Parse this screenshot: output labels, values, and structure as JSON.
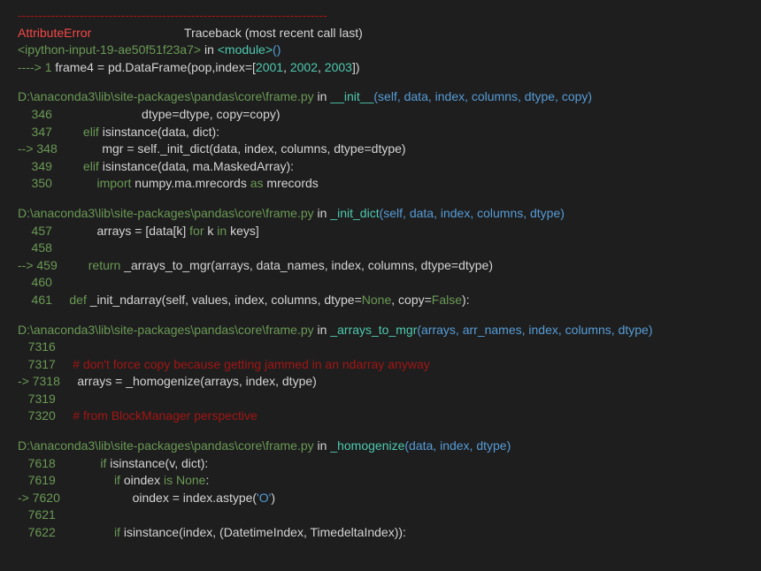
{
  "header": {
    "separator": "---------------------------------------------------------------------------",
    "error_name": "AttributeError",
    "traceback_label": "Traceback (most recent call last)",
    "ipython_open": "<ipython-input-19-ae50f51f23a7>",
    "in": " in ",
    "module_open": "<module>",
    "paren_open": "(",
    "paren_close": ")",
    "arrow": "----> 1 ",
    "code_frame4": "frame4 ",
    "code_eq": "= ",
    "code_pd": "pd",
    "code_dot": ".",
    "code_df": "DataFrame",
    "code_p1": "(",
    "code_pop": "pop",
    "code_comma": ",",
    "code_index": "index",
    "code_eq2": "=",
    "code_lb": "[",
    "code_2001": "2001",
    "code_c1": ", ",
    "code_2002": "2002",
    "code_c2": ", ",
    "code_2003": "2003",
    "code_rb": "]",
    "code_p2": ")"
  },
  "frames": [
    {
      "path": "D:\\anaconda3\\lib\\site-packages\\pandas\\core\\frame.py",
      "in": " in ",
      "func": "__init__",
      "sig": "(self, data, index, columns, dtype, copy)",
      "lines": [
        {
          "arrow": "",
          "no": "    346 ",
          "parts": [
            {
              "t": "                         dtype",
              "c": "c-white"
            },
            {
              "t": "=",
              "c": "c-white"
            },
            {
              "t": "dtype, copy",
              "c": "c-white"
            },
            {
              "t": "=",
              "c": "c-white"
            },
            {
              "t": "copy)",
              "c": "c-white"
            }
          ]
        },
        {
          "arrow": "",
          "no": "    347 ",
          "parts": [
            {
              "t": "        elif ",
              "c": "c-green"
            },
            {
              "t": "isinstance",
              "c": "c-white"
            },
            {
              "t": "(",
              "c": "c-white"
            },
            {
              "t": "data",
              "c": "c-white"
            },
            {
              "t": ", ",
              "c": "c-white"
            },
            {
              "t": "dict",
              "c": "c-white"
            },
            {
              "t": "):",
              "c": "c-white"
            }
          ]
        },
        {
          "arrow": "--> ",
          "no": "348 ",
          "parts": [
            {
              "t": "            mgr ",
              "c": "c-white"
            },
            {
              "t": "= ",
              "c": "c-white"
            },
            {
              "t": "self",
              "c": "c-white"
            },
            {
              "t": ".",
              "c": "c-white"
            },
            {
              "t": "_init_dict",
              "c": "c-white"
            },
            {
              "t": "(",
              "c": "c-white"
            },
            {
              "t": "data",
              "c": "c-white"
            },
            {
              "t": ", ",
              "c": "c-white"
            },
            {
              "t": "index",
              "c": "c-white"
            },
            {
              "t": ", ",
              "c": "c-white"
            },
            {
              "t": "columns",
              "c": "c-white"
            },
            {
              "t": ", ",
              "c": "c-white"
            },
            {
              "t": "dtype",
              "c": "c-white"
            },
            {
              "t": "=",
              "c": "c-white"
            },
            {
              "t": "dtype)",
              "c": "c-white"
            }
          ]
        },
        {
          "arrow": "",
          "no": "    349 ",
          "parts": [
            {
              "t": "        elif ",
              "c": "c-green"
            },
            {
              "t": "isinstance",
              "c": "c-white"
            },
            {
              "t": "(",
              "c": "c-white"
            },
            {
              "t": "data",
              "c": "c-white"
            },
            {
              "t": ", ",
              "c": "c-white"
            },
            {
              "t": "ma",
              "c": "c-white"
            },
            {
              "t": ".",
              "c": "c-white"
            },
            {
              "t": "MaskedArray",
              "c": "c-white"
            },
            {
              "t": "):",
              "c": "c-white"
            }
          ]
        },
        {
          "arrow": "",
          "no": "    350 ",
          "parts": [
            {
              "t": "            import ",
              "c": "c-green"
            },
            {
              "t": "numpy",
              "c": "c-white"
            },
            {
              "t": ".",
              "c": "c-white"
            },
            {
              "t": "ma",
              "c": "c-white"
            },
            {
              "t": ".",
              "c": "c-white"
            },
            {
              "t": "mrecords ",
              "c": "c-white"
            },
            {
              "t": "as ",
              "c": "c-green"
            },
            {
              "t": "mrecords",
              "c": "c-white"
            }
          ]
        }
      ]
    },
    {
      "path": "D:\\anaconda3\\lib\\site-packages\\pandas\\core\\frame.py",
      "in": " in ",
      "func": "_init_dict",
      "sig": "(self, data, index, columns, dtype)",
      "lines": [
        {
          "arrow": "",
          "no": "    457 ",
          "parts": [
            {
              "t": "            arrays ",
              "c": "c-white"
            },
            {
              "t": "= ",
              "c": "c-white"
            },
            {
              "t": "[",
              "c": "c-white"
            },
            {
              "t": "data",
              "c": "c-white"
            },
            {
              "t": "[",
              "c": "c-white"
            },
            {
              "t": "k",
              "c": "c-white"
            },
            {
              "t": "] ",
              "c": "c-white"
            },
            {
              "t": "for ",
              "c": "c-green"
            },
            {
              "t": "k ",
              "c": "c-white"
            },
            {
              "t": "in ",
              "c": "c-green"
            },
            {
              "t": "keys",
              "c": "c-white"
            },
            {
              "t": "]",
              "c": "c-white"
            }
          ]
        },
        {
          "arrow": "",
          "no": "    458 ",
          "parts": []
        },
        {
          "arrow": "--> ",
          "no": "459 ",
          "parts": [
            {
              "t": "        return ",
              "c": "c-green"
            },
            {
              "t": "_arrays_to_mgr",
              "c": "c-white"
            },
            {
              "t": "(",
              "c": "c-white"
            },
            {
              "t": "arrays",
              "c": "c-white"
            },
            {
              "t": ", ",
              "c": "c-white"
            },
            {
              "t": "data_names",
              "c": "c-white"
            },
            {
              "t": ", ",
              "c": "c-white"
            },
            {
              "t": "index",
              "c": "c-white"
            },
            {
              "t": ", ",
              "c": "c-white"
            },
            {
              "t": "columns",
              "c": "c-white"
            },
            {
              "t": ", ",
              "c": "c-white"
            },
            {
              "t": "dtype",
              "c": "c-white"
            },
            {
              "t": "=",
              "c": "c-white"
            },
            {
              "t": "dtype)",
              "c": "c-white"
            }
          ]
        },
        {
          "arrow": "",
          "no": "    460 ",
          "parts": []
        },
        {
          "arrow": "",
          "no": "    461 ",
          "parts": [
            {
              "t": "    def ",
              "c": "c-green"
            },
            {
              "t": "_init_ndarray",
              "c": "c-white"
            },
            {
              "t": "(",
              "c": "c-white"
            },
            {
              "t": "self",
              "c": "c-white"
            },
            {
              "t": ", ",
              "c": "c-white"
            },
            {
              "t": "values",
              "c": "c-white"
            },
            {
              "t": ", ",
              "c": "c-white"
            },
            {
              "t": "index",
              "c": "c-white"
            },
            {
              "t": ", ",
              "c": "c-white"
            },
            {
              "t": "columns",
              "c": "c-white"
            },
            {
              "t": ", ",
              "c": "c-white"
            },
            {
              "t": "dtype",
              "c": "c-white"
            },
            {
              "t": "=",
              "c": "c-white"
            },
            {
              "t": "None",
              "c": "c-green"
            },
            {
              "t": ", copy",
              "c": "c-white"
            },
            {
              "t": "=",
              "c": "c-white"
            },
            {
              "t": "False",
              "c": "c-green"
            },
            {
              "t": "):",
              "c": "c-white"
            }
          ]
        }
      ]
    },
    {
      "path": "D:\\anaconda3\\lib\\site-packages\\pandas\\core\\frame.py",
      "in": " in ",
      "func": "_arrays_to_mgr",
      "sig": "(arrays, arr_names, index, columns, dtype)",
      "lines": [
        {
          "arrow": "",
          "no": "   7316 ",
          "parts": []
        },
        {
          "arrow": "",
          "no": "   7317 ",
          "parts": [
            {
              "t": "    # don't force copy because getting jammed in an ndarray anyway",
              "c": "c-darkred"
            }
          ]
        },
        {
          "arrow": "-> ",
          "no": "7318 ",
          "parts": [
            {
              "t": "    arrays ",
              "c": "c-white"
            },
            {
              "t": "= ",
              "c": "c-white"
            },
            {
              "t": "_homogenize",
              "c": "c-white"
            },
            {
              "t": "(",
              "c": "c-white"
            },
            {
              "t": "arrays",
              "c": "c-white"
            },
            {
              "t": ", ",
              "c": "c-white"
            },
            {
              "t": "index",
              "c": "c-white"
            },
            {
              "t": ", ",
              "c": "c-white"
            },
            {
              "t": "dtype)",
              "c": "c-white"
            }
          ]
        },
        {
          "arrow": "",
          "no": "   7319 ",
          "parts": []
        },
        {
          "arrow": "",
          "no": "   7320 ",
          "parts": [
            {
              "t": "    # from BlockManager perspective",
              "c": "c-darkred"
            }
          ]
        }
      ]
    },
    {
      "path": "D:\\anaconda3\\lib\\site-packages\\pandas\\core\\frame.py",
      "in": " in ",
      "func": "_homogenize",
      "sig": "(data, index, dtype)",
      "lines": [
        {
          "arrow": "",
          "no": "   7618 ",
          "parts": [
            {
              "t": "            if ",
              "c": "c-green"
            },
            {
              "t": "isinstance",
              "c": "c-white"
            },
            {
              "t": "(",
              "c": "c-white"
            },
            {
              "t": "v",
              "c": "c-white"
            },
            {
              "t": ", ",
              "c": "c-white"
            },
            {
              "t": "dict",
              "c": "c-white"
            },
            {
              "t": "):",
              "c": "c-white"
            }
          ]
        },
        {
          "arrow": "",
          "no": "   7619 ",
          "parts": [
            {
              "t": "                if ",
              "c": "c-green"
            },
            {
              "t": "oindex ",
              "c": "c-white"
            },
            {
              "t": "is ",
              "c": "c-green"
            },
            {
              "t": "None",
              "c": "c-green"
            },
            {
              "t": ":",
              "c": "c-white"
            }
          ]
        },
        {
          "arrow": "-> ",
          "no": "7620 ",
          "parts": [
            {
              "t": "                    oindex ",
              "c": "c-white"
            },
            {
              "t": "= ",
              "c": "c-white"
            },
            {
              "t": "index",
              "c": "c-white"
            },
            {
              "t": ".",
              "c": "c-white"
            },
            {
              "t": "astype",
              "c": "c-white"
            },
            {
              "t": "(",
              "c": "c-white"
            },
            {
              "t": "'O'",
              "c": "c-blue"
            },
            {
              "t": ")",
              "c": "c-white"
            }
          ]
        },
        {
          "arrow": "",
          "no": "   7621 ",
          "parts": []
        },
        {
          "arrow": "",
          "no": "   7622 ",
          "parts": [
            {
              "t": "                if ",
              "c": "c-green"
            },
            {
              "t": "isinstance",
              "c": "c-white"
            },
            {
              "t": "(",
              "c": "c-white"
            },
            {
              "t": "index",
              "c": "c-white"
            },
            {
              "t": ", ",
              "c": "c-white"
            },
            {
              "t": "(",
              "c": "c-white"
            },
            {
              "t": "DatetimeIndex",
              "c": "c-white"
            },
            {
              "t": ", ",
              "c": "c-white"
            },
            {
              "t": "TimedeltaIndex",
              "c": "c-white"
            },
            {
              "t": ")):",
              "c": "c-white"
            }
          ]
        }
      ]
    }
  ]
}
